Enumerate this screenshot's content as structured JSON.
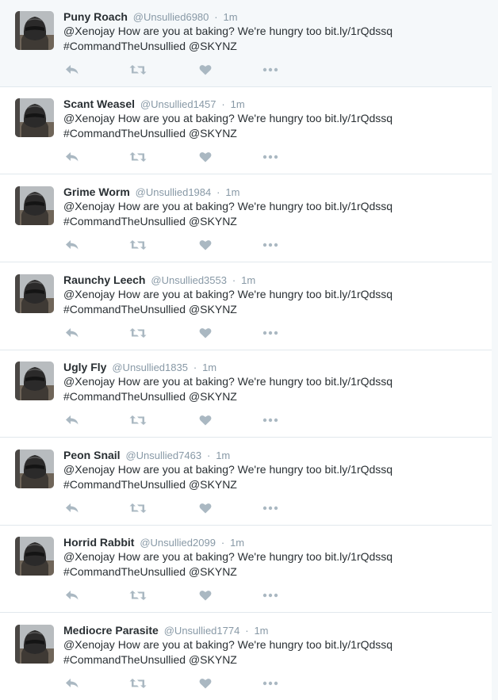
{
  "timeline": {
    "tweets": [
      {
        "fullname": "Puny Roach",
        "username": "@Unsullied6980",
        "separator": "·",
        "time": "1m",
        "mention": "@Xenojay",
        "body": " How are you at baking? We're hungry too ",
        "link": "bit.ly/1rQdssq",
        "hashtag": "#CommandTheUnsullied",
        "mention2": "@SKYNZ"
      },
      {
        "fullname": "Scant Weasel",
        "username": "@Unsullied1457",
        "separator": "·",
        "time": "1m",
        "mention": "@Xenojay",
        "body": " How are you at baking? We're hungry too ",
        "link": "bit.ly/1rQdssq",
        "hashtag": "#CommandTheUnsullied",
        "mention2": "@SKYNZ"
      },
      {
        "fullname": "Grime Worm",
        "username": "@Unsullied1984",
        "separator": "·",
        "time": "1m",
        "mention": "@Xenojay",
        "body": " How are you at baking? We're hungry too ",
        "link": "bit.ly/1rQdssq",
        "hashtag": "#CommandTheUnsullied",
        "mention2": "@SKYNZ"
      },
      {
        "fullname": "Raunchy Leech",
        "username": "@Unsullied3553",
        "separator": "·",
        "time": "1m",
        "mention": "@Xenojay",
        "body": " How are you at baking? We're hungry too ",
        "link": "bit.ly/1rQdssq",
        "hashtag": "#CommandTheUnsullied",
        "mention2": "@SKYNZ"
      },
      {
        "fullname": "Ugly Fly",
        "username": "@Unsullied1835",
        "separator": "·",
        "time": "1m",
        "mention": "@Xenojay",
        "body": " How are you at baking? We're hungry too ",
        "link": "bit.ly/1rQdssq",
        "hashtag": "#CommandTheUnsullied",
        "mention2": "@SKYNZ"
      },
      {
        "fullname": "Peon Snail",
        "username": "@Unsullied7463",
        "separator": "·",
        "time": "1m",
        "mention": "@Xenojay",
        "body": " How are you at baking? We're hungry too ",
        "link": "bit.ly/1rQdssq",
        "hashtag": "#CommandTheUnsullied",
        "mention2": "@SKYNZ"
      },
      {
        "fullname": "Horrid Rabbit",
        "username": "@Unsullied2099",
        "separator": "·",
        "time": "1m",
        "mention": "@Xenojay",
        "body": " How are you at baking? We're hungry too ",
        "link": "bit.ly/1rQdssq",
        "hashtag": "#CommandTheUnsullied",
        "mention2": "@SKYNZ"
      },
      {
        "fullname": "Mediocre Parasite",
        "username": "@Unsullied1774",
        "separator": "·",
        "time": "1m",
        "mention": "@Xenojay",
        "body": " How are you at baking? We're hungry too ",
        "link": "bit.ly/1rQdssq",
        "hashtag": "#CommandTheUnsullied",
        "mention2": "@SKYNZ"
      }
    ],
    "action_icons": [
      "reply-icon",
      "retweet-icon",
      "like-icon",
      "more-icon"
    ],
    "icon_color": "#aab8c2",
    "name_color": "#292f33",
    "meta_color": "#8899a6"
  }
}
